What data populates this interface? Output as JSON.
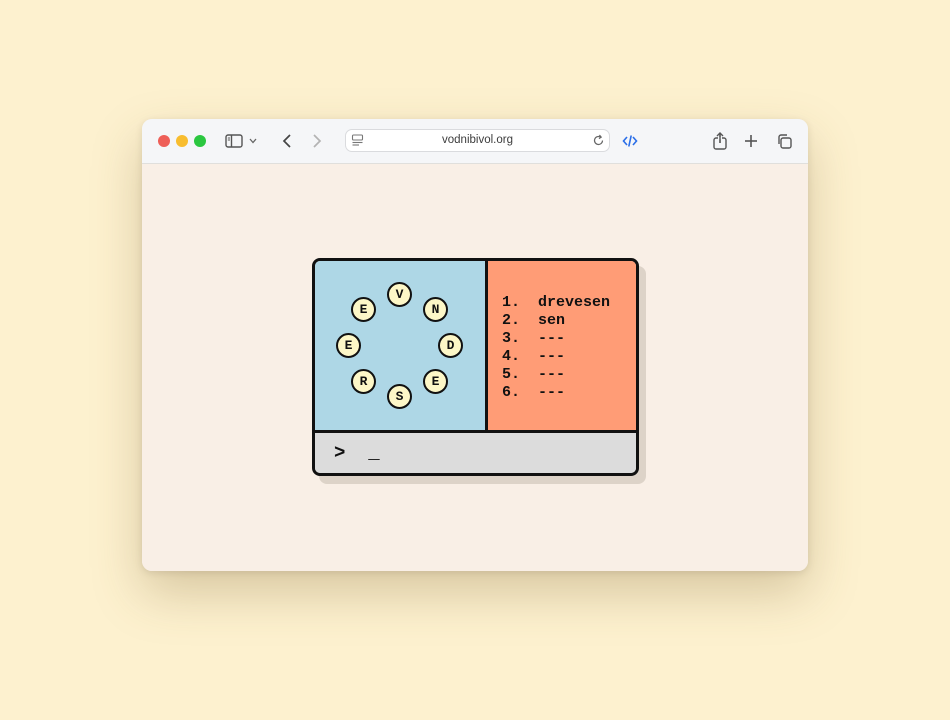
{
  "browser": {
    "url": "vodnibivol.org",
    "icons": {
      "sidebar": "sidebar-icon",
      "sidebar_menu": "chevron-down-icon",
      "back": "chevron-left-icon",
      "forward": "chevron-right-icon",
      "page": "page-menu-icon",
      "reload": "reload-icon",
      "devtools": "code-icon",
      "share": "share-icon",
      "new_tab": "plus-icon",
      "tabs": "tab-overview-icon"
    },
    "colors": {
      "accent": "#2a6ee8",
      "page_bg": "#fdf1cf"
    }
  },
  "game": {
    "letters": [
      "V",
      "N",
      "D",
      "E",
      "S",
      "R",
      "E",
      "E"
    ],
    "words": [
      "1.  drevesen",
      "2.  sen",
      "3.  ---",
      "4.  ---",
      "5.  ---",
      "6.  ---"
    ],
    "prompt": ">  _",
    "colors": {
      "letters_panel": "#aed7e6",
      "words_panel": "#ff9c76",
      "letter_tile": "#fdf7c7",
      "prompt_bar": "#dcdcdc"
    }
  }
}
